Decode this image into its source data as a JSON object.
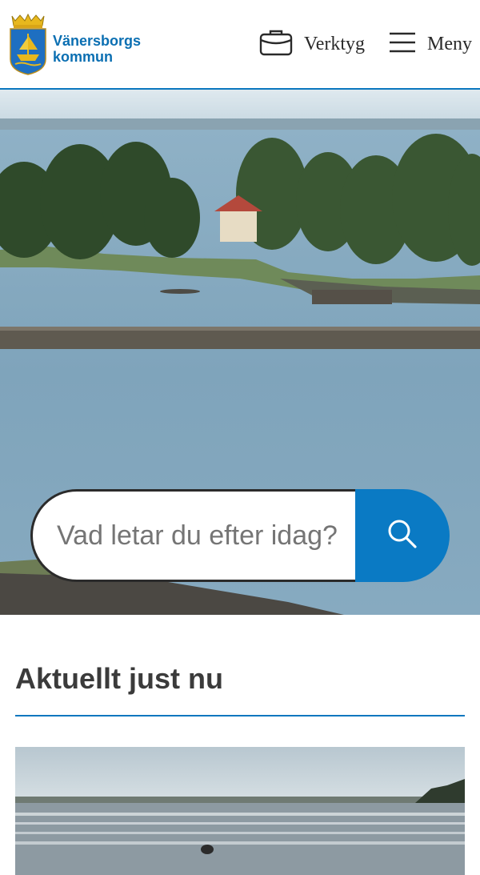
{
  "header": {
    "brand_line1": "Vänersborgs",
    "brand_line2": "kommun",
    "logo_icon": "coat-of-arms-icon",
    "tools_label": "Verktyg",
    "tools_icon": "briefcase-icon",
    "menu_label": "Meny",
    "menu_icon": "hamburger-menu-icon"
  },
  "search": {
    "placeholder": "Vad letar du efter idag?",
    "button_icon": "search-icon"
  },
  "section": {
    "title": "Aktuellt just nu"
  },
  "colors": {
    "brand_blue": "#0b77bf",
    "search_button": "#0a7ac4",
    "text_dark": "#3b3b3b"
  }
}
